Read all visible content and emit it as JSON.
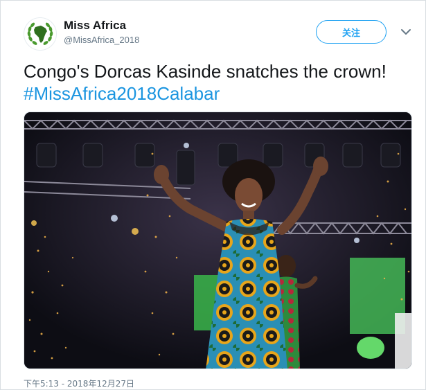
{
  "account": {
    "name": "Miss Africa",
    "handle": "@MissAfrica_2018",
    "avatar_icon": "africa-map-laurel-icon"
  },
  "actions": {
    "follow_label": "关注",
    "menu_icon": "chevron-down-icon"
  },
  "tweet": {
    "text": "Congo's Dorcas Kasinde snatches the crown!",
    "hashtag": "#MissAfrica2018Calabar",
    "timestamp": "下午5:13 - 2018年12月27日"
  },
  "photo": {
    "description_icon": "stage-photo"
  },
  "colors": {
    "accent": "#1da1f2",
    "hashtag": "#1b95e0",
    "muted": "#657786"
  }
}
